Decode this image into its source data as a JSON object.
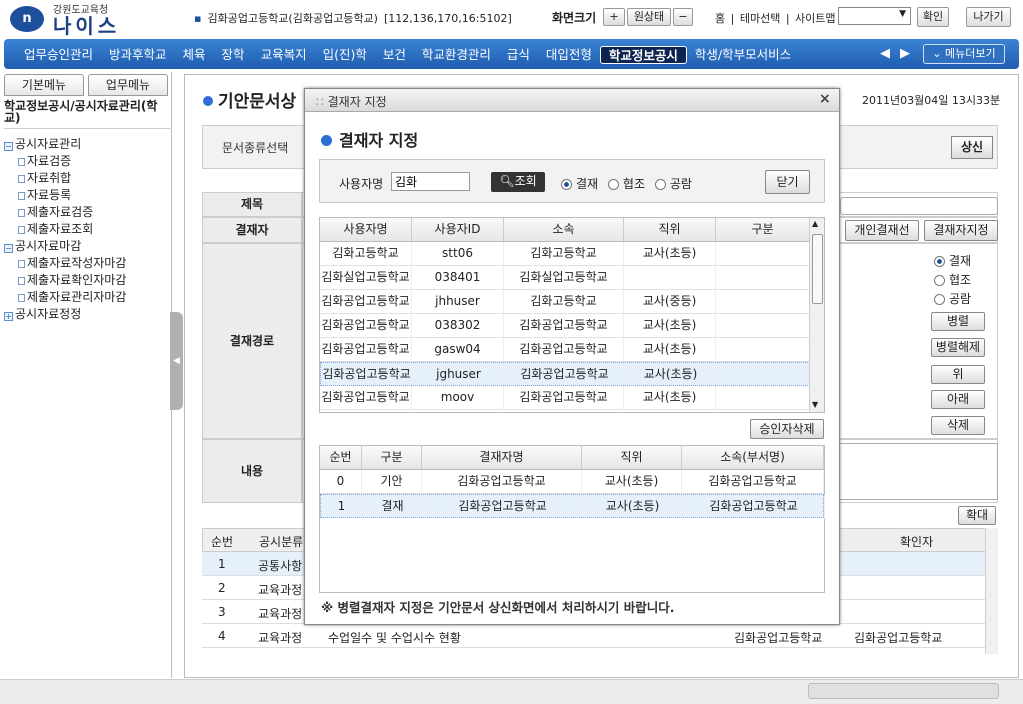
{
  "header": {
    "logo_mark": "n",
    "logo_sub": "강원도교육청",
    "logo_name": "나이스",
    "school": "김화공업고등학교(김화공업고등학교)",
    "ip": "[112,136,170,16:5102]",
    "screen_size_label": "화면크기",
    "plus": "+",
    "normal": "원상태",
    "minus": "−",
    "links": [
      "홈",
      "|",
      "테마선택",
      "|",
      "사이트맵"
    ],
    "confirm": "확인",
    "exit": "나가기"
  },
  "nav": {
    "items": [
      "업무승인관리",
      "방과후학교",
      "체육",
      "장학",
      "교육복지",
      "입(진)학",
      "보건",
      "학교환경관리",
      "급식",
      "대입전형",
      "학교정보공시",
      "학생/학부모서비스"
    ],
    "active_index": 10,
    "prev": "◀",
    "next": "▶",
    "menu_more": "메뉴더보기"
  },
  "sidebar": {
    "tabs": [
      "기본메뉴",
      "업무메뉴"
    ],
    "title": "학교정보공시/공시자료관리(학교)",
    "tree": [
      {
        "label": "공시자료관리",
        "level": 0,
        "expander": "−"
      },
      {
        "label": "자료검증",
        "level": 1
      },
      {
        "label": "자료취합",
        "level": 1
      },
      {
        "label": "자료등록",
        "level": 1
      },
      {
        "label": "제출자료검증",
        "level": 1
      },
      {
        "label": "제출자료조회",
        "level": 1
      },
      {
        "label": "공시자료마감",
        "level": 0,
        "expander": "−"
      },
      {
        "label": "제출자료작성자마감",
        "level": 1
      },
      {
        "label": "제출자료확인자마감",
        "level": 1
      },
      {
        "label": "제출자료관리자마감",
        "level": 1
      },
      {
        "label": "공시자료정정",
        "level": 0,
        "expander": "+"
      }
    ]
  },
  "main": {
    "title": "기안문서상",
    "date": "2011년03월04일 13시33분",
    "doc_type_label": "문서종류선택",
    "submit": "상신",
    "labels": {
      "subject": "제목",
      "approver": "결재자",
      "route": "결재경로",
      "content": "내용"
    },
    "personal_line": "개인결재선",
    "approver_assign": "결재자지정",
    "route_options": [
      "결재",
      "협조",
      "공람"
    ],
    "route_selected": 0,
    "route_buttons": [
      "병렬",
      "병렬해제",
      "위",
      "아래",
      "삭제"
    ],
    "expand": "확대",
    "bottom_table": {
      "headers": [
        "순번",
        "공시분류",
        "확인자"
      ],
      "rows": [
        {
          "no": "1",
          "cat": "공통사항",
          "title": "",
          "org": "",
          "confirmer": ""
        },
        {
          "no": "2",
          "cat": "교육과정",
          "title": "",
          "org": "",
          "confirmer": ""
        },
        {
          "no": "3",
          "cat": "교육과정",
          "title": "",
          "org": "",
          "confirmer": ""
        },
        {
          "no": "4",
          "cat": "교육과정",
          "title": "수업일수 및 수업시수 현황",
          "org": "김화공업고등학교",
          "confirmer": "김화공업고등학교"
        }
      ]
    }
  },
  "dialog": {
    "title": "결재자 지정",
    "heading": "결재자 지정",
    "close_icon": "×",
    "user_label": "사용자명",
    "user_value": "김화",
    "query": "조회",
    "options": [
      "결재",
      "협조",
      "공람"
    ],
    "option_selected": 0,
    "close_btn": "닫기",
    "user_table": {
      "headers": [
        "사용자명",
        "사용자ID",
        "소속",
        "직위",
        "구분"
      ],
      "rows": [
        [
          "김화고등학교",
          "stt06",
          "김화고등학교",
          "교사(초등)",
          ""
        ],
        [
          "김화실업고등학교",
          "038401",
          "김화실업고등학교",
          "",
          ""
        ],
        [
          "김화공업고등학교",
          "jhhuser",
          "김화고등학교",
          "교사(중등)",
          ""
        ],
        [
          "김화공업고등학교",
          "038302",
          "김화공업고등학교",
          "교사(초등)",
          ""
        ],
        [
          "김화공업고등학교",
          "gasw04",
          "김화공업고등학교",
          "교사(초등)",
          ""
        ],
        [
          "김화공업고등학교",
          "jghuser",
          "김화공업고등학교",
          "교사(초등)",
          ""
        ],
        [
          "김화공업고등학교",
          "moov",
          "김화공업고등학교",
          "교사(초등)",
          ""
        ]
      ],
      "selected_index": 5
    },
    "delete_approver": "승인자삭제",
    "approval_table": {
      "headers": [
        "순번",
        "구분",
        "결재자명",
        "직위",
        "소속(부서명)"
      ],
      "rows": [
        [
          "0",
          "기안",
          "김화공업고등학교",
          "교사(초등)",
          "김화공업고등학교"
        ],
        [
          "1",
          "결재",
          "김화공업고등학교",
          "교사(초등)",
          "김화공업고등학교"
        ]
      ],
      "selected_index": 1
    },
    "note": "※ 병렬결재자 지정은 기안문서 상신화면에서 처리하시기 바랍니다."
  },
  "colors": {
    "nav_top": "#3b84d6",
    "nav_bottom": "#1f5cae",
    "active_tab": "#0c2450",
    "accent": "#2d6fd0",
    "selected_row": "#e6f0fb"
  }
}
